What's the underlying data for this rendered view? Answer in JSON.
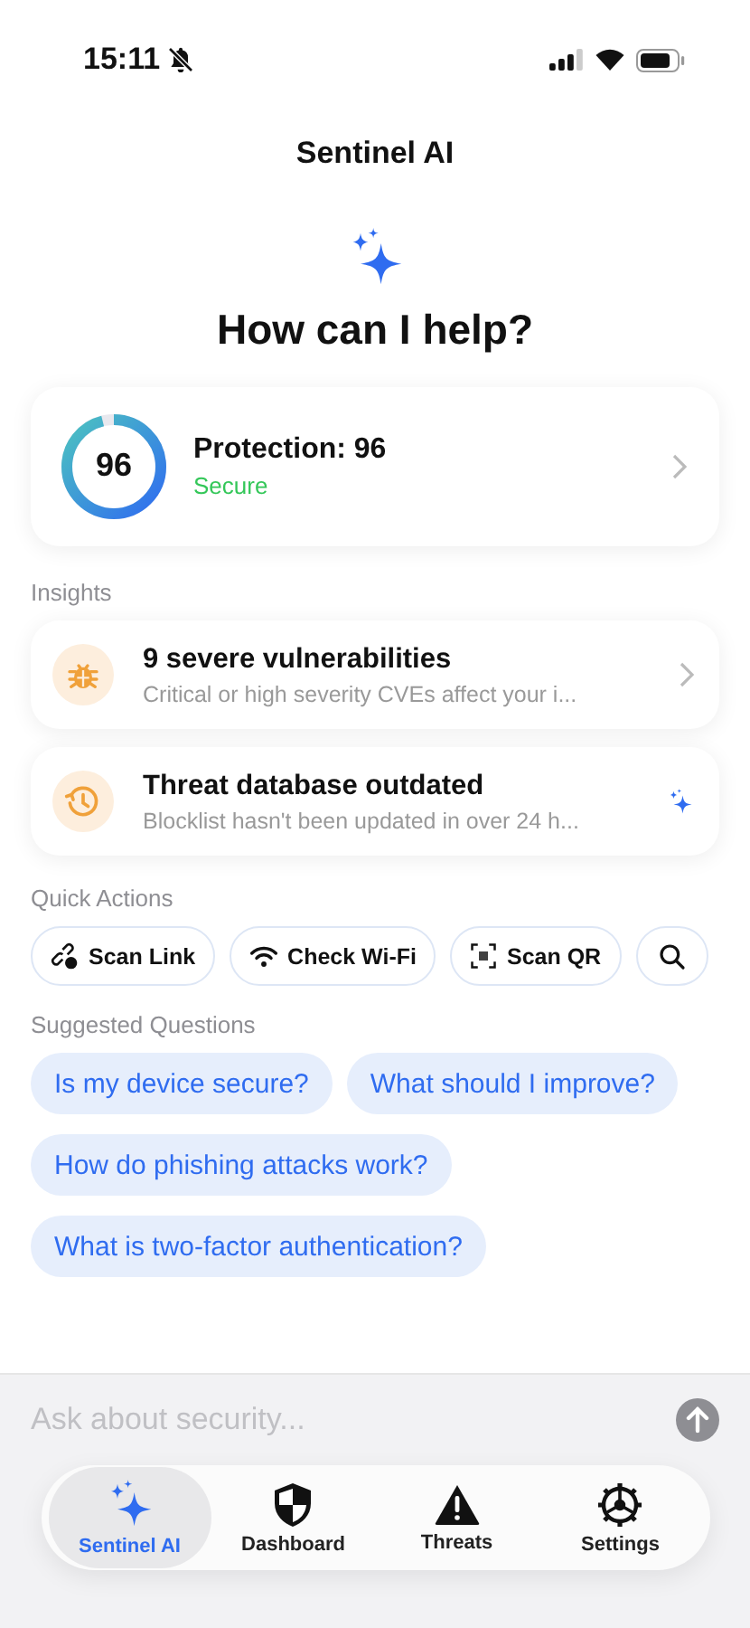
{
  "status_bar": {
    "time": "15:11",
    "silenced": true
  },
  "header": {
    "title": "Sentinel AI"
  },
  "hero": {
    "heading": "How can I help?"
  },
  "protection": {
    "score": "96",
    "level": 0.96,
    "title": "Protection: 96",
    "status": "Secure",
    "color": "#34c759"
  },
  "insights": {
    "label": "Insights",
    "items": [
      {
        "kind": "bug",
        "title": "9 severe vulnerabilities",
        "subtitle": "Critical or high severity CVEs affect your i..."
      },
      {
        "kind": "clock",
        "title": "Threat database outdated",
        "subtitle": "Blocklist hasn't been updated in over 24 h..."
      }
    ]
  },
  "quick_actions": {
    "label": "Quick Actions",
    "items": [
      {
        "kind": "link",
        "label": "Scan Link"
      },
      {
        "kind": "wifi",
        "label": "Check Wi-Fi"
      },
      {
        "kind": "qr",
        "label": "Scan QR"
      },
      {
        "kind": "search"
      }
    ]
  },
  "suggested_questions": {
    "label": "Suggested Questions",
    "items": [
      "Is my device secure?",
      "What should I improve?",
      "How do phishing attacks work?",
      "What is two-factor authentication?"
    ]
  },
  "composer": {
    "placeholder": "Ask about security..."
  },
  "tab_bar": [
    {
      "kind": "sparkle",
      "label": "Sentinel AI",
      "selected": true
    },
    {
      "kind": "shield",
      "label": "Dashboard",
      "selected": false
    },
    {
      "kind": "warning",
      "label": "Threats",
      "selected": false
    },
    {
      "kind": "gear",
      "label": "Settings",
      "selected": false
    }
  ]
}
